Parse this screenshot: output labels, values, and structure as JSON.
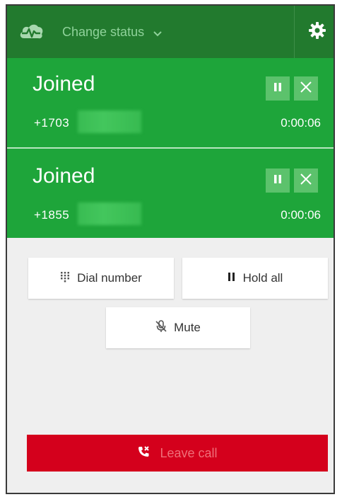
{
  "header": {
    "logo_icon": "cloud-pulse-icon",
    "status_label": "Change status",
    "settings_icon": "gear-icon"
  },
  "calls": [
    {
      "state": "Joined",
      "phone": "+1703",
      "timer": "0:00:06"
    },
    {
      "state": "Joined",
      "phone": "+1855",
      "timer": "0:00:06"
    }
  ],
  "actions": {
    "dial_label": "Dial number",
    "hold_label": "Hold all",
    "mute_label": "Mute",
    "leave_label": "Leave call"
  },
  "colors": {
    "header_bg": "#227a2e",
    "joined_bg": "#1ea53a",
    "leave_bg": "#d4001c"
  }
}
